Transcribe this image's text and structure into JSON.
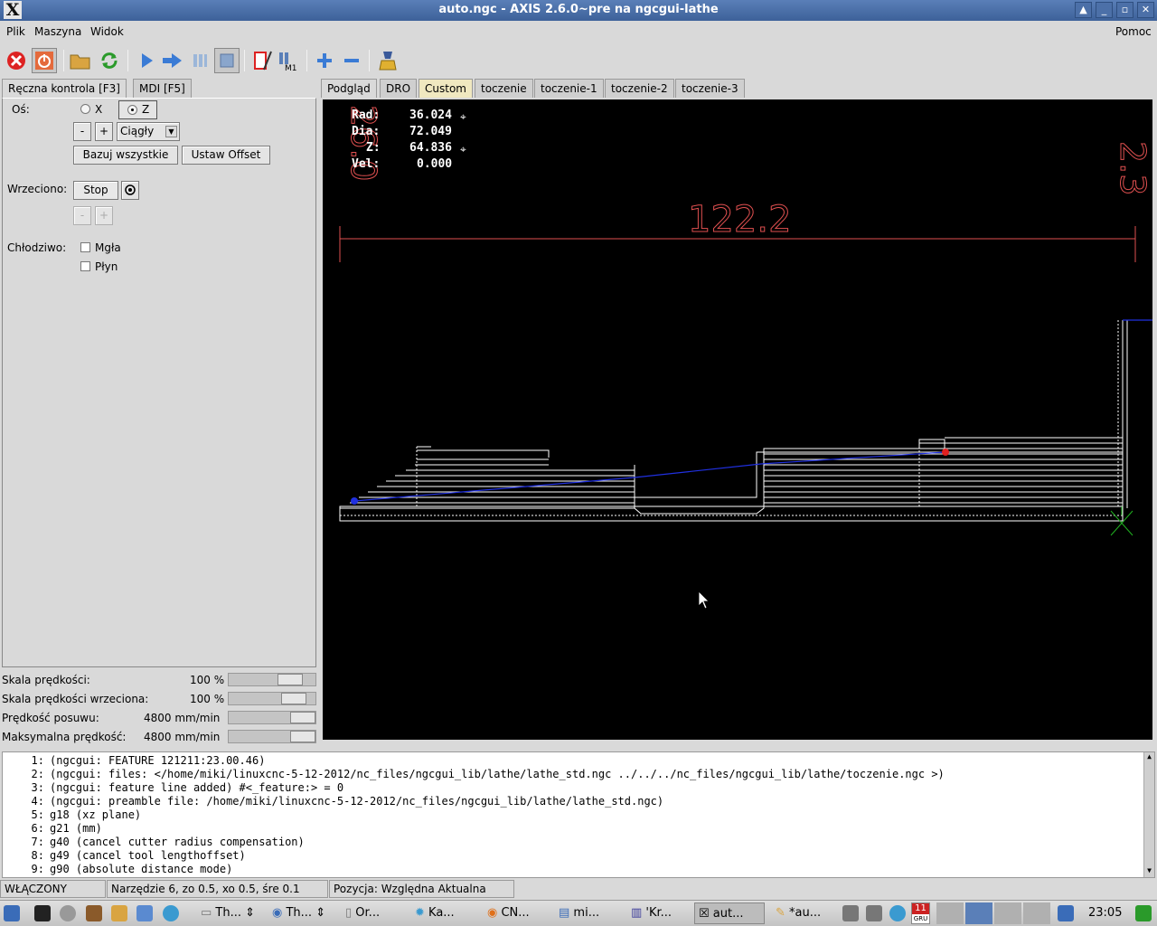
{
  "window": {
    "title": "auto.ngc - AXIS 2.6.0~pre na ngcgui-lathe",
    "logo": "X"
  },
  "menu": [
    "Plik",
    "Maszyna",
    "Widok",
    "Pomoc"
  ],
  "left_tabs": [
    "Ręczna kontrola [F3]",
    "MDI [F5]"
  ],
  "manual": {
    "axis_label": "Oś:",
    "axis_x": "X",
    "axis_z": "Z",
    "axis_selected": "Z",
    "minus": "-",
    "plus": "+",
    "jog_mode": "Ciągły",
    "home_all": "Bazuj wszystkie",
    "set_offset": "Ustaw Offset",
    "spindle_label": "Wrzeciono:",
    "spindle_stop": "Stop",
    "coolant_label": "Chłodziwo:",
    "mist": "Mgła",
    "flood": "Płyn"
  },
  "sliders": [
    {
      "name": "Skala prędkości:",
      "value": "100 %",
      "level": 0.8
    },
    {
      "name": "Skala prędkości wrzeciona:",
      "value": "100 %",
      "level": 0.85
    },
    {
      "name": "Prędkość posuwu:",
      "value": "4800 mm/min",
      "level": 1.0
    },
    {
      "name": "Maksymalna prędkość:",
      "value": "4800 mm/min",
      "level": 1.0
    }
  ],
  "right_tabs": [
    "Podgląd",
    "DRO",
    "Custom",
    "toczenie",
    "toczenie-1",
    "toczenie-2",
    "toczenie-3"
  ],
  "dro": {
    "rad_label": "Rad:",
    "rad": "36.024",
    "dia_label": "Dia:",
    "dia": "72.049",
    "z_label": "Z:",
    "z": "64.836",
    "vel_label": "Vel:",
    "vel": "0.000"
  },
  "preview": {
    "dimension_main": "122.2",
    "dimension_left": "26.0",
    "dimension_right": "2.3"
  },
  "listing": [
    {
      "n": "1:",
      "text": "(ngcgui: FEATURE 121211:23.00.46)"
    },
    {
      "n": "2:",
      "text": "(ngcgui: files: </home/miki/linuxcnc-5-12-2012/nc_files/ngcgui_lib/lathe/lathe_std.ngc ../../../nc_files/ngcgui_lib/lathe/toczenie.ngc >)"
    },
    {
      "n": "3:",
      "text": "(ngcgui: feature line added) #<_feature:> = 0"
    },
    {
      "n": "4:",
      "text": "(ngcgui: preamble file: /home/miki/linuxcnc-5-12-2012/nc_files/ngcgui_lib/lathe/lathe_std.ngc)"
    },
    {
      "n": "5:",
      "text": "g18 (xz plane)"
    },
    {
      "n": "6:",
      "text": "g21 (mm)"
    },
    {
      "n": "7:",
      "text": "g40 (cancel cutter radius compensation)"
    },
    {
      "n": "8:",
      "text": "g49 (cancel tool lengthoffset)"
    },
    {
      "n": "9:",
      "text": "g90 (absolute distance mode)"
    }
  ],
  "status": {
    "state": "WŁĄCZONY",
    "tool": "Narzędzie 6, zo 0.5, xo 0.5, śre 0.1",
    "position": "Pozycja: Względna Aktualna"
  },
  "taskbar": {
    "tasks": [
      "Th...",
      "Th...",
      "Or...",
      "Ka...",
      "CN...",
      "mi...",
      "'Kr...",
      "aut...",
      "*au..."
    ],
    "calendar_day": "11",
    "calendar_month": "GRU",
    "clock": "23:05"
  }
}
